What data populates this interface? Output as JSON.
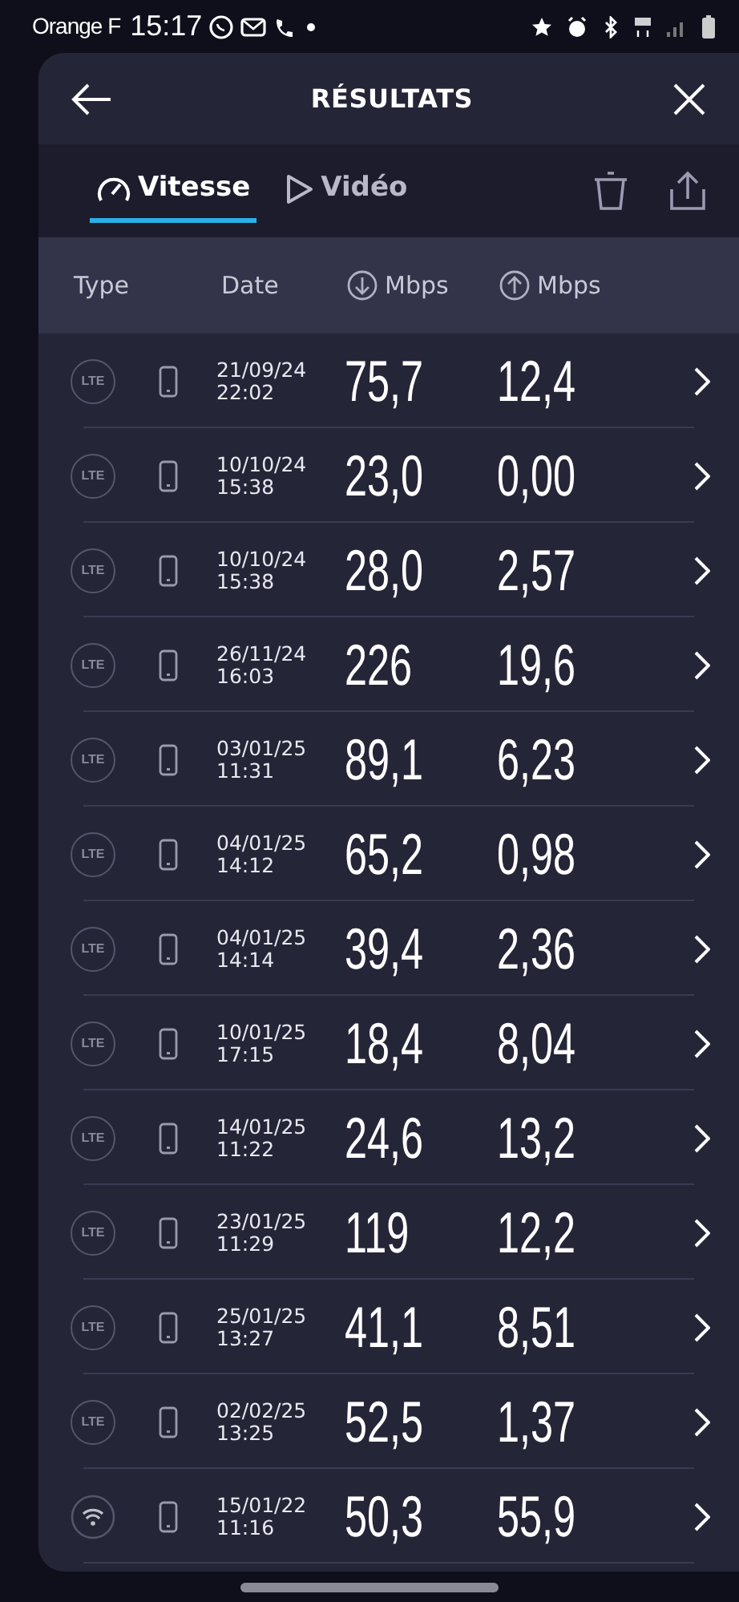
{
  "status_bar": {
    "carrier": "Orange F",
    "time": "15:17"
  },
  "header": {
    "title": "RÉSULTATS"
  },
  "tabs": [
    {
      "kind": "speed",
      "label": "Vitesse",
      "selected": true
    },
    {
      "kind": "video",
      "label": "Vidéo",
      "selected": false
    }
  ],
  "columns": [
    {
      "kind": "plain",
      "label": "Type"
    },
    {
      "kind": "plain",
      "label": "Date"
    },
    {
      "kind": "down",
      "label": "Mbps"
    },
    {
      "kind": "up",
      "label": "Mbps"
    }
  ],
  "rows": [
    {
      "kind": "lte",
      "type_label": "LTE",
      "date": "21/09/24",
      "time": "22:02",
      "download": "75,7",
      "upload": "12,4"
    },
    {
      "kind": "lte",
      "type_label": "LTE",
      "date": "10/10/24",
      "time": "15:38",
      "download": "23,0",
      "upload": "0,00"
    },
    {
      "kind": "lte",
      "type_label": "LTE",
      "date": "10/10/24",
      "time": "15:38",
      "download": "28,0",
      "upload": "2,57"
    },
    {
      "kind": "lte",
      "type_label": "LTE",
      "date": "26/11/24",
      "time": "16:03",
      "download": "226",
      "upload": "19,6"
    },
    {
      "kind": "lte",
      "type_label": "LTE",
      "date": "03/01/25",
      "time": "11:31",
      "download": "89,1",
      "upload": "6,23"
    },
    {
      "kind": "lte",
      "type_label": "LTE",
      "date": "04/01/25",
      "time": "14:12",
      "download": "65,2",
      "upload": "0,98"
    },
    {
      "kind": "lte",
      "type_label": "LTE",
      "date": "04/01/25",
      "time": "14:14",
      "download": "39,4",
      "upload": "2,36"
    },
    {
      "kind": "lte",
      "type_label": "LTE",
      "date": "10/01/25",
      "time": "17:15",
      "download": "18,4",
      "upload": "8,04"
    },
    {
      "kind": "lte",
      "type_label": "LTE",
      "date": "14/01/25",
      "time": "11:22",
      "download": "24,6",
      "upload": "13,2"
    },
    {
      "kind": "lte",
      "type_label": "LTE",
      "date": "23/01/25",
      "time": "11:29",
      "download": "119",
      "upload": "12,2"
    },
    {
      "kind": "lte",
      "type_label": "LTE",
      "date": "25/01/25",
      "time": "13:27",
      "download": "41,1",
      "upload": "8,51"
    },
    {
      "kind": "lte",
      "type_label": "LTE",
      "date": "02/02/25",
      "time": "13:25",
      "download": "52,5",
      "upload": "1,37"
    },
    {
      "kind": "wifi",
      "date": "15/01/22",
      "time": "11:16",
      "download": "50,3",
      "upload": "55,9"
    }
  ]
}
